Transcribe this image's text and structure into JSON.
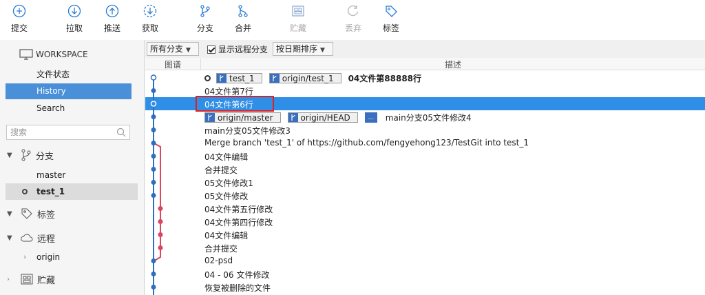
{
  "toolbar": {
    "commit": "提交",
    "pull": "拉取",
    "push": "推送",
    "fetch": "获取",
    "branch": "分支",
    "merge": "合并",
    "stash": "贮藏",
    "discard": "丢弃",
    "tag": "标签"
  },
  "sidebar": {
    "workspace": "WORKSPACE",
    "file_status": "文件状态",
    "history": "History",
    "search": "Search",
    "search_placeholder": "搜索",
    "branches_label": "分支",
    "branches": [
      "master",
      "test_1"
    ],
    "tags_label": "标签",
    "remotes_label": "远程",
    "remote_origin": "origin",
    "stashes_label": "贮藏"
  },
  "filter": {
    "branches_select": "所有分支",
    "show_remote": "显示远程分支",
    "sort_select": "按日期排序"
  },
  "columns": {
    "graph": "图谱",
    "description": "描述"
  },
  "commits": [
    {
      "message": "04文件第88888行",
      "tags": [
        "test_1",
        "origin/test_1"
      ],
      "head": true
    },
    {
      "message": "04文件第7行"
    },
    {
      "message": "04文件第6行",
      "selected": true
    },
    {
      "message": "main分支05文件修改4",
      "tags": [
        "origin/master",
        "origin/HEAD"
      ],
      "more": "..."
    },
    {
      "message": "main分支05文件修改3"
    },
    {
      "message": "Merge branch 'test_1' of https://github.com/fengyehong123/TestGit into test_1"
    },
    {
      "message": "04文件编辑"
    },
    {
      "message": "合并提交"
    },
    {
      "message": "05文件修改1"
    },
    {
      "message": "05文件修改"
    },
    {
      "message": "04文件第五行修改"
    },
    {
      "message": "04文件第四行修改"
    },
    {
      "message": "04文件编辑"
    },
    {
      "message": "合并提交"
    },
    {
      "message": "02-psd"
    },
    {
      "message": "04 - 06 文件修改"
    },
    {
      "message": "恢复被删除的文件"
    }
  ],
  "colors": {
    "accent": "#4a90d9",
    "selected_row": "#2f8ee5",
    "graph_main": "#2e6fbd",
    "graph_branch": "#d9465e",
    "highlight_box": "#e02020"
  }
}
